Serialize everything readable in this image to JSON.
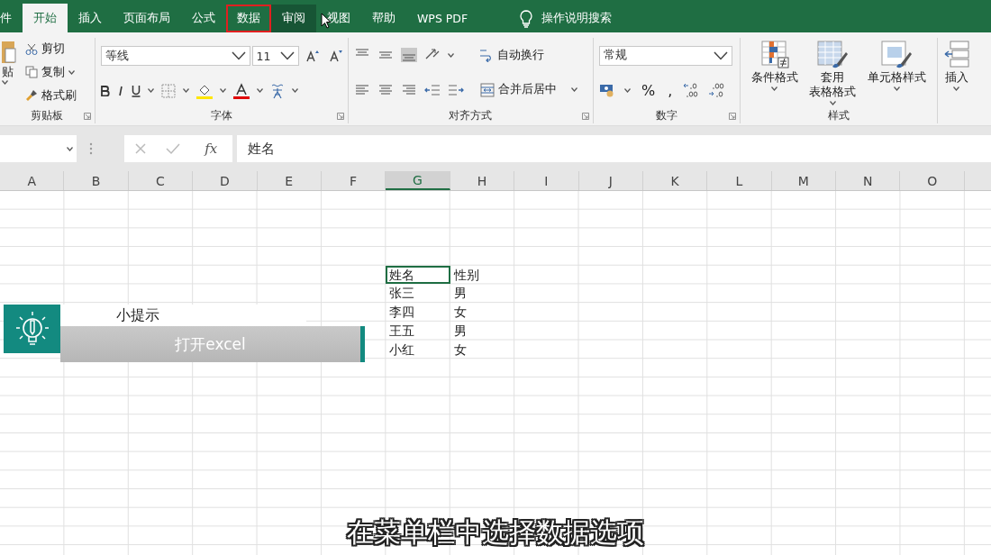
{
  "tabs": [
    {
      "label": "件",
      "selected": false,
      "hovered": false,
      "marked": false
    },
    {
      "label": "开始",
      "selected": true,
      "hovered": false,
      "marked": false
    },
    {
      "label": "插入",
      "selected": false,
      "hovered": false,
      "marked": false
    },
    {
      "label": "页面布局",
      "selected": false,
      "hovered": false,
      "marked": false
    },
    {
      "label": "公式",
      "selected": false,
      "hovered": false,
      "marked": false
    },
    {
      "label": "数据",
      "selected": false,
      "hovered": false,
      "marked": true
    },
    {
      "label": "审阅",
      "selected": false,
      "hovered": true,
      "marked": false
    },
    {
      "label": "视图",
      "selected": false,
      "hovered": false,
      "marked": false
    },
    {
      "label": "帮助",
      "selected": false,
      "hovered": false,
      "marked": false
    },
    {
      "label": "WPS PDF",
      "selected": false,
      "hovered": false,
      "marked": false
    }
  ],
  "search": {
    "placeholder": "操作说明搜索"
  },
  "ribbon": {
    "clipboard": {
      "paste": "贴",
      "cut": "剪切",
      "copy": "复制",
      "format_painter": "格式刷",
      "label": "剪贴板"
    },
    "font": {
      "font_name": "等线",
      "font_size": "11",
      "label": "字体"
    },
    "alignment": {
      "wrap_text": "自动换行",
      "merge_center": "合并后居中",
      "label": "对齐方式"
    },
    "number": {
      "format": "常规",
      "percent": "%",
      "comma": ",",
      "label": "数字"
    },
    "styles": {
      "buttons": [
        {
          "lines": [
            "条件格式"
          ]
        },
        {
          "lines": [
            "套用",
            "表格格式"
          ]
        },
        {
          "lines": [
            "单元格样式"
          ]
        }
      ],
      "label": "样式"
    },
    "cells": {
      "insert": "插入"
    }
  },
  "formula_bar": {
    "function_label": "fx",
    "value": "姓名"
  },
  "columns": [
    {
      "label": "A",
      "selected": false
    },
    {
      "label": "B",
      "selected": false
    },
    {
      "label": "C",
      "selected": false
    },
    {
      "label": "D",
      "selected": false
    },
    {
      "label": "E",
      "selected": false
    },
    {
      "label": "F",
      "selected": false
    },
    {
      "label": "G",
      "selected": true
    },
    {
      "label": "H",
      "selected": false
    },
    {
      "label": "I",
      "selected": false
    },
    {
      "label": "J",
      "selected": false
    },
    {
      "label": "K",
      "selected": false
    },
    {
      "label": "L",
      "selected": false
    },
    {
      "label": "M",
      "selected": false
    },
    {
      "label": "N",
      "selected": false
    },
    {
      "label": "O",
      "selected": false
    }
  ],
  "table": {
    "rows": [
      {
        "cells": [
          {
            "text": "姓名",
            "selected": true
          },
          {
            "text": "性别",
            "selected": false
          }
        ]
      },
      {
        "cells": [
          {
            "text": "张三",
            "selected": false
          },
          {
            "text": "男",
            "selected": false
          }
        ]
      },
      {
        "cells": [
          {
            "text": "李四",
            "selected": false
          },
          {
            "text": "女",
            "selected": false
          }
        ]
      },
      {
        "cells": [
          {
            "text": "王五",
            "selected": false
          },
          {
            "text": "男",
            "selected": false
          }
        ]
      },
      {
        "cells": [
          {
            "text": "小红",
            "selected": false
          },
          {
            "text": "女",
            "selected": false
          }
        ]
      }
    ]
  },
  "tip": {
    "title": "小提示",
    "text": "打开excel"
  },
  "subtitle": "在菜单栏中选择数据选项"
}
